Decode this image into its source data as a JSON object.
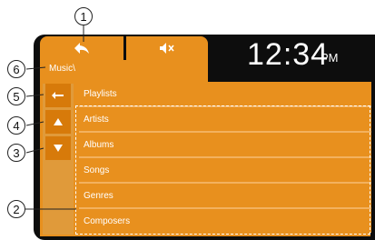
{
  "clock": {
    "time": "12:34",
    "ampm": "PM"
  },
  "breadcrumb": "Music\\",
  "tabs": {
    "back_icon": "back-arrow-icon",
    "mute_icon": "mute-icon"
  },
  "sidebar": {
    "back_icon": "back-icon",
    "up_icon": "up-arrow-icon",
    "down_icon": "down-arrow-icon"
  },
  "menu": {
    "items": [
      {
        "label": "Playlists"
      },
      {
        "label": "Artists"
      },
      {
        "label": "Albums"
      },
      {
        "label": "Songs"
      },
      {
        "label": "Genres"
      },
      {
        "label": "Composers"
      }
    ]
  },
  "callouts": [
    "1",
    "2",
    "3",
    "4",
    "5",
    "6"
  ],
  "colors": {
    "accent": "#e8901e",
    "frame": "#0d0d0d",
    "sidebar": "#e09a3a"
  }
}
